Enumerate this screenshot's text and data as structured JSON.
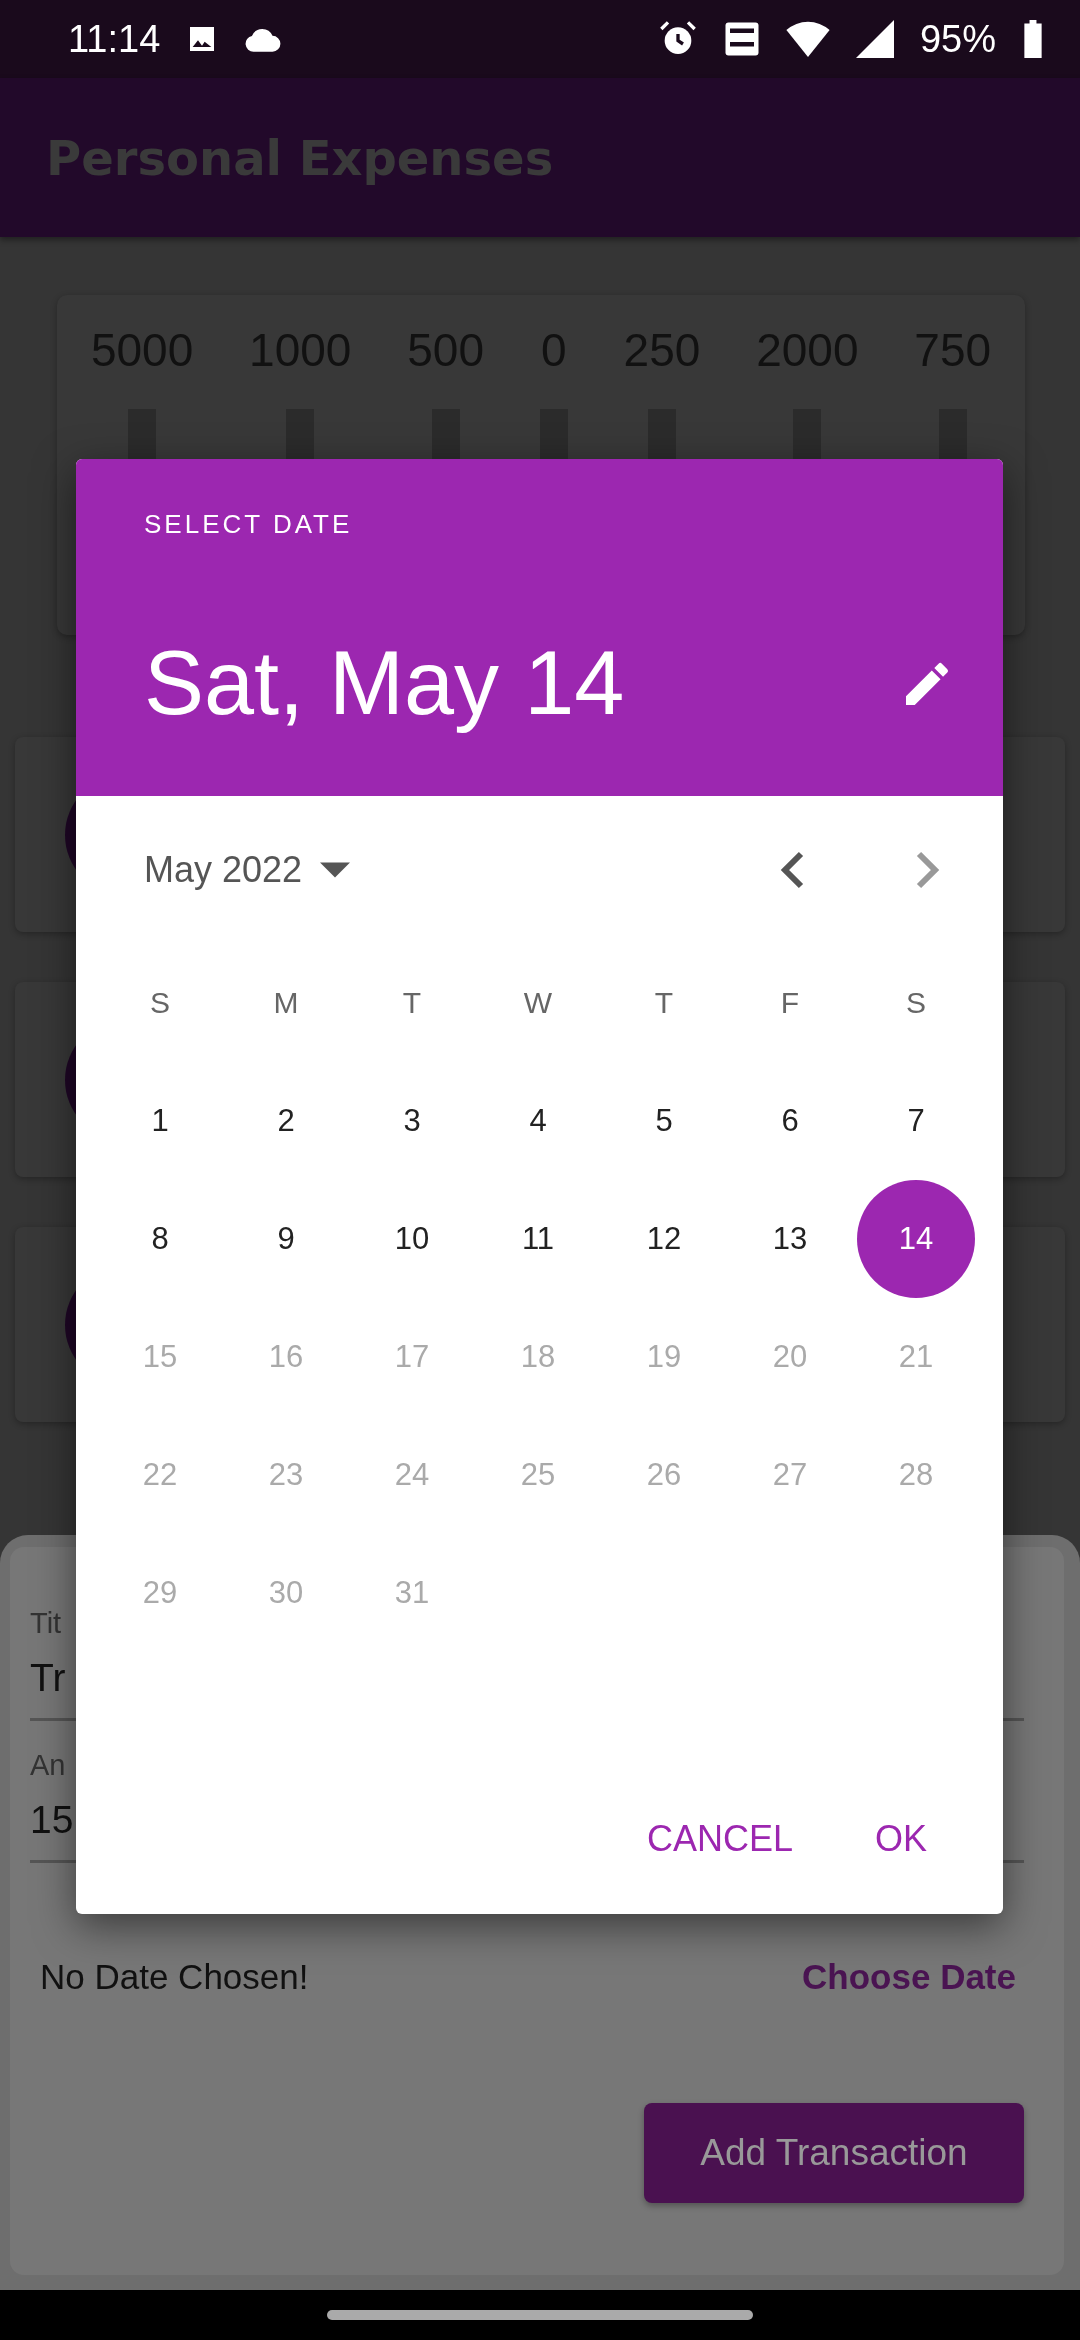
{
  "status_bar": {
    "time": "11:14",
    "battery": "95%"
  },
  "app_bar": {
    "title": "Personal Expenses"
  },
  "chart": {
    "bars": [
      {
        "amount": "5000"
      },
      {
        "amount": "1000"
      },
      {
        "amount": "500"
      },
      {
        "amount": "0"
      },
      {
        "amount": "250"
      },
      {
        "amount": "2000"
      },
      {
        "amount": "750"
      }
    ]
  },
  "date_picker": {
    "heading": "SELECT DATE",
    "selected_date": "Sat, May 14",
    "month_label": "May 2022",
    "weekdays": [
      "S",
      "M",
      "T",
      "W",
      "T",
      "F",
      "S"
    ],
    "days": [
      {
        "label": "1",
        "selected": false,
        "disabled": false
      },
      {
        "label": "2",
        "selected": false,
        "disabled": false
      },
      {
        "label": "3",
        "selected": false,
        "disabled": false
      },
      {
        "label": "4",
        "selected": false,
        "disabled": false
      },
      {
        "label": "5",
        "selected": false,
        "disabled": false
      },
      {
        "label": "6",
        "selected": false,
        "disabled": false
      },
      {
        "label": "7",
        "selected": false,
        "disabled": false
      },
      {
        "label": "8",
        "selected": false,
        "disabled": false
      },
      {
        "label": "9",
        "selected": false,
        "disabled": false
      },
      {
        "label": "10",
        "selected": false,
        "disabled": false
      },
      {
        "label": "11",
        "selected": false,
        "disabled": false
      },
      {
        "label": "12",
        "selected": false,
        "disabled": false
      },
      {
        "label": "13",
        "selected": false,
        "disabled": false
      },
      {
        "label": "14",
        "selected": true,
        "disabled": false
      },
      {
        "label": "15",
        "selected": false,
        "disabled": true
      },
      {
        "label": "16",
        "selected": false,
        "disabled": true
      },
      {
        "label": "17",
        "selected": false,
        "disabled": true
      },
      {
        "label": "18",
        "selected": false,
        "disabled": true
      },
      {
        "label": "19",
        "selected": false,
        "disabled": true
      },
      {
        "label": "20",
        "selected": false,
        "disabled": true
      },
      {
        "label": "21",
        "selected": false,
        "disabled": true
      },
      {
        "label": "22",
        "selected": false,
        "disabled": true
      },
      {
        "label": "23",
        "selected": false,
        "disabled": true
      },
      {
        "label": "24",
        "selected": false,
        "disabled": true
      },
      {
        "label": "25",
        "selected": false,
        "disabled": true
      },
      {
        "label": "26",
        "selected": false,
        "disabled": true
      },
      {
        "label": "27",
        "selected": false,
        "disabled": true
      },
      {
        "label": "28",
        "selected": false,
        "disabled": true
      },
      {
        "label": "29",
        "selected": false,
        "disabled": true
      },
      {
        "label": "30",
        "selected": false,
        "disabled": true
      },
      {
        "label": "31",
        "selected": false,
        "disabled": true
      }
    ],
    "buttons": [
      {
        "label": "CANCEL"
      },
      {
        "label": "OK"
      }
    ]
  },
  "new_transaction": {
    "title_label": "Tit",
    "title_value": "Tr",
    "amount_label": "An",
    "amount_value": "15",
    "date_status": "No Date Chosen!",
    "choose_date": "Choose Date",
    "submit": "Add Transaction"
  }
}
